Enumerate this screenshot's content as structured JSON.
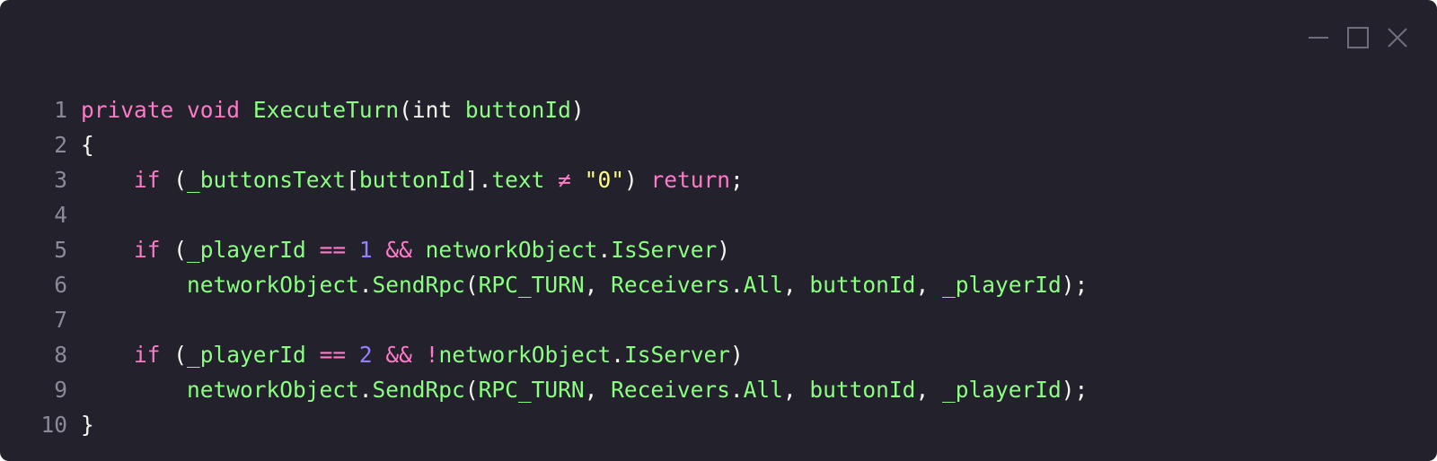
{
  "window": {
    "controls": [
      "minimize-icon",
      "maximize-icon",
      "close-icon"
    ],
    "colors": {
      "background": "#22212c",
      "keyword": "#ff7ac6",
      "identifier": "#8aff80",
      "plain": "#f8f8f2",
      "number": "#9580ff",
      "string": "#ffff80",
      "line_number": "#8b8a96"
    }
  },
  "code": {
    "lines": [
      {
        "n": "1",
        "tokens": [
          {
            "t": "private",
            "c": "kw"
          },
          {
            "t": " ",
            "c": "pl"
          },
          {
            "t": "void",
            "c": "kw"
          },
          {
            "t": " ",
            "c": "pl"
          },
          {
            "t": "ExecuteTurn",
            "c": "fn"
          },
          {
            "t": "(",
            "c": "pl"
          },
          {
            "t": "int",
            "c": "pl"
          },
          {
            "t": " ",
            "c": "pl"
          },
          {
            "t": "buttonId",
            "c": "id"
          },
          {
            "t": ")",
            "c": "pl"
          }
        ]
      },
      {
        "n": "2",
        "tokens": [
          {
            "t": "{",
            "c": "pl"
          }
        ]
      },
      {
        "n": "3",
        "tokens": [
          {
            "t": "    ",
            "c": "pl"
          },
          {
            "t": "if",
            "c": "kw"
          },
          {
            "t": " (",
            "c": "pl"
          },
          {
            "t": "_buttonsText",
            "c": "id"
          },
          {
            "t": "[",
            "c": "pl"
          },
          {
            "t": "buttonId",
            "c": "id"
          },
          {
            "t": "].",
            "c": "pl"
          },
          {
            "t": "text",
            "c": "id"
          },
          {
            "t": " ",
            "c": "pl"
          },
          {
            "t": "≠",
            "c": "op"
          },
          {
            "t": " ",
            "c": "pl"
          },
          {
            "t": "\"",
            "c": "str"
          },
          {
            "t": "0",
            "c": "str"
          },
          {
            "t": "\"",
            "c": "str"
          },
          {
            "t": ") ",
            "c": "pl"
          },
          {
            "t": "return",
            "c": "kw"
          },
          {
            "t": ";",
            "c": "pl"
          }
        ]
      },
      {
        "n": "4",
        "tokens": []
      },
      {
        "n": "5",
        "tokens": [
          {
            "t": "    ",
            "c": "pl"
          },
          {
            "t": "if",
            "c": "kw"
          },
          {
            "t": " (",
            "c": "pl"
          },
          {
            "t": "_playerId",
            "c": "id"
          },
          {
            "t": " ",
            "c": "pl"
          },
          {
            "t": "==",
            "c": "op"
          },
          {
            "t": " ",
            "c": "pl"
          },
          {
            "t": "1",
            "c": "num"
          },
          {
            "t": " ",
            "c": "pl"
          },
          {
            "t": "&&",
            "c": "op"
          },
          {
            "t": " ",
            "c": "pl"
          },
          {
            "t": "networkObject",
            "c": "id"
          },
          {
            "t": ".",
            "c": "pl"
          },
          {
            "t": "IsServer",
            "c": "id"
          },
          {
            "t": ")",
            "c": "pl"
          }
        ]
      },
      {
        "n": "6",
        "tokens": [
          {
            "t": "        ",
            "c": "pl"
          },
          {
            "t": "networkObject",
            "c": "id"
          },
          {
            "t": ".",
            "c": "pl"
          },
          {
            "t": "SendRpc",
            "c": "fn"
          },
          {
            "t": "(",
            "c": "pl"
          },
          {
            "t": "RPC_TURN",
            "c": "id"
          },
          {
            "t": ", ",
            "c": "pl"
          },
          {
            "t": "Receivers",
            "c": "id"
          },
          {
            "t": ".",
            "c": "pl"
          },
          {
            "t": "All",
            "c": "id"
          },
          {
            "t": ", ",
            "c": "pl"
          },
          {
            "t": "buttonId",
            "c": "id"
          },
          {
            "t": ", ",
            "c": "pl"
          },
          {
            "t": "_playerId",
            "c": "id"
          },
          {
            "t": ");",
            "c": "pl"
          }
        ]
      },
      {
        "n": "7",
        "tokens": []
      },
      {
        "n": "8",
        "tokens": [
          {
            "t": "    ",
            "c": "pl"
          },
          {
            "t": "if",
            "c": "kw"
          },
          {
            "t": " (",
            "c": "pl"
          },
          {
            "t": "_playerId",
            "c": "id"
          },
          {
            "t": " ",
            "c": "pl"
          },
          {
            "t": "==",
            "c": "op"
          },
          {
            "t": " ",
            "c": "pl"
          },
          {
            "t": "2",
            "c": "num"
          },
          {
            "t": " ",
            "c": "pl"
          },
          {
            "t": "&&",
            "c": "op"
          },
          {
            "t": " ",
            "c": "pl"
          },
          {
            "t": "!",
            "c": "op"
          },
          {
            "t": "networkObject",
            "c": "id"
          },
          {
            "t": ".",
            "c": "pl"
          },
          {
            "t": "IsServer",
            "c": "id"
          },
          {
            "t": ")",
            "c": "pl"
          }
        ]
      },
      {
        "n": "9",
        "tokens": [
          {
            "t": "        ",
            "c": "pl"
          },
          {
            "t": "networkObject",
            "c": "id"
          },
          {
            "t": ".",
            "c": "pl"
          },
          {
            "t": "SendRpc",
            "c": "fn"
          },
          {
            "t": "(",
            "c": "pl"
          },
          {
            "t": "RPC_TURN",
            "c": "id"
          },
          {
            "t": ", ",
            "c": "pl"
          },
          {
            "t": "Receivers",
            "c": "id"
          },
          {
            "t": ".",
            "c": "pl"
          },
          {
            "t": "All",
            "c": "id"
          },
          {
            "t": ", ",
            "c": "pl"
          },
          {
            "t": "buttonId",
            "c": "id"
          },
          {
            "t": ", ",
            "c": "pl"
          },
          {
            "t": "_playerId",
            "c": "id"
          },
          {
            "t": ");",
            "c": "pl"
          }
        ]
      },
      {
        "n": "10",
        "tokens": [
          {
            "t": "}",
            "c": "pl"
          }
        ]
      }
    ]
  }
}
